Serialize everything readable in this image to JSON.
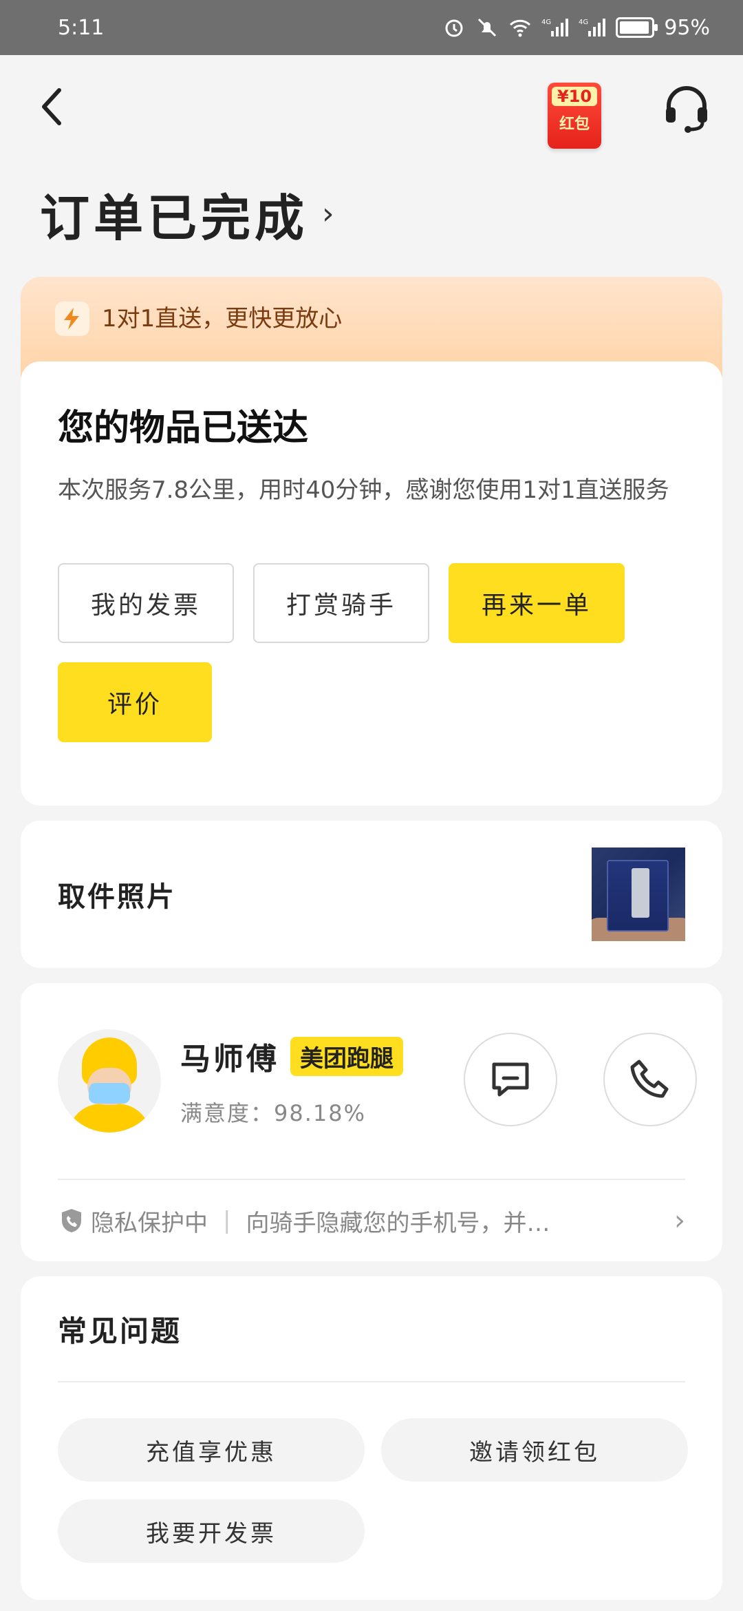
{
  "status_bar": {
    "time": "5:11",
    "battery": "95%"
  },
  "header": {
    "red_packet_amount": "¥10",
    "red_packet_label": "红包",
    "title": "订单已完成",
    "title_chevron": "›"
  },
  "promo": {
    "text": "1对1直送，更快更放心"
  },
  "delivery": {
    "heading": "您的物品已送达",
    "description": "本次服务7.8公里，用时40分钟，感谢您使用1对1直送服务",
    "buttons": [
      "我的发票",
      "打赏骑手",
      "再来一单",
      "评价"
    ]
  },
  "photo": {
    "label": "取件照片"
  },
  "rider": {
    "name": "马师傅",
    "badge": "美团跑腿",
    "rating": "满意度：98.18%",
    "privacy_label": "隐私保护中",
    "privacy_desc": "向骑手隐藏您的手机号，并…"
  },
  "faq": {
    "title": "常见问题",
    "items": [
      "充值享优惠",
      "邀请领红包",
      "我要开发票"
    ]
  },
  "colors": {
    "accent_yellow": "#ffde1f",
    "promo_bg": "#ffd3a6",
    "page_bg": "#f4f4f4"
  }
}
